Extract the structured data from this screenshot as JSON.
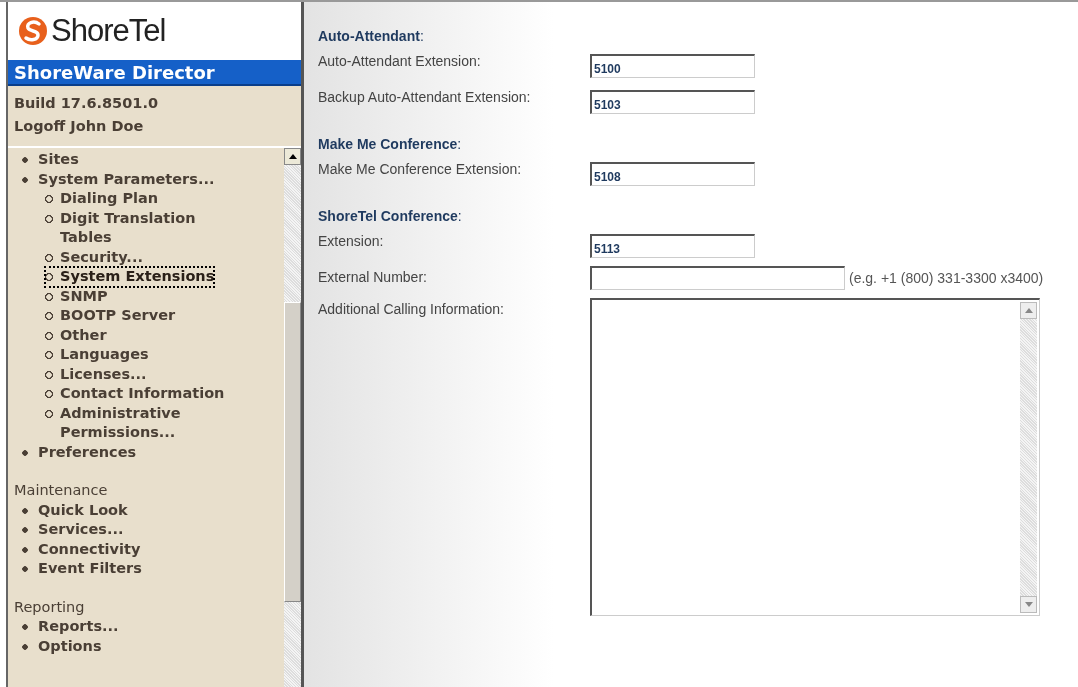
{
  "sidebar": {
    "logo": "ShoreTel",
    "product": "ShoreWare Director",
    "build": "Build 17.6.8501.0",
    "logoff": "Logoff John Doe",
    "groups": [
      {
        "items": [
          {
            "label": "Sites",
            "selected": false
          },
          {
            "label": "System Parameters...",
            "selected": false,
            "children": [
              {
                "label": "Dialing Plan",
                "selected": false
              },
              {
                "label": "Digit Translation Tables",
                "selected": false
              },
              {
                "label": "Security...",
                "selected": false
              },
              {
                "label": "System Extensions",
                "selected": true
              },
              {
                "label": "SNMP",
                "selected": false
              },
              {
                "label": "BOOTP Server",
                "selected": false
              },
              {
                "label": "Other",
                "selected": false
              },
              {
                "label": "Languages",
                "selected": false
              },
              {
                "label": "Licenses...",
                "selected": false
              },
              {
                "label": "Contact Information",
                "selected": false
              },
              {
                "label": "Administrative Permissions...",
                "selected": false
              }
            ]
          },
          {
            "label": "Preferences",
            "selected": false
          }
        ]
      },
      {
        "heading": "Maintenance",
        "items": [
          {
            "label": "Quick Look",
            "selected": false
          },
          {
            "label": "Services...",
            "selected": false
          },
          {
            "label": "Connectivity",
            "selected": false
          },
          {
            "label": "Event Filters",
            "selected": false
          }
        ]
      },
      {
        "heading": "Reporting",
        "items": [
          {
            "label": "Reports...",
            "selected": false
          },
          {
            "label": "Options",
            "selected": false
          }
        ]
      }
    ]
  },
  "sections": [
    {
      "heading": "**Auto-Attendant**:",
      "fields": [
        {
          "kind": "text",
          "label": "Auto-Attendant Extension:",
          "value": "5100"
        },
        {
          "kind": "text",
          "label": "Backup Auto-Attendant Extension:",
          "value": "5103"
        }
      ]
    },
    {
      "heading": "**Make Me Conference**:",
      "fields": [
        {
          "kind": "text",
          "label": "Make Me Conference Extension:",
          "value": "5108"
        }
      ]
    },
    {
      "heading": "**ShoreTel Conference**:",
      "fields": [
        {
          "kind": "text",
          "label": "Extension:",
          "value": "5113"
        },
        {
          "kind": "wide",
          "label": "External Number:",
          "hint": "(e.g. +1 (800) 331-3300 x3400)"
        },
        {
          "kind": "textarea",
          "label": "Additional Calling Information:"
        }
      ]
    }
  ]
}
